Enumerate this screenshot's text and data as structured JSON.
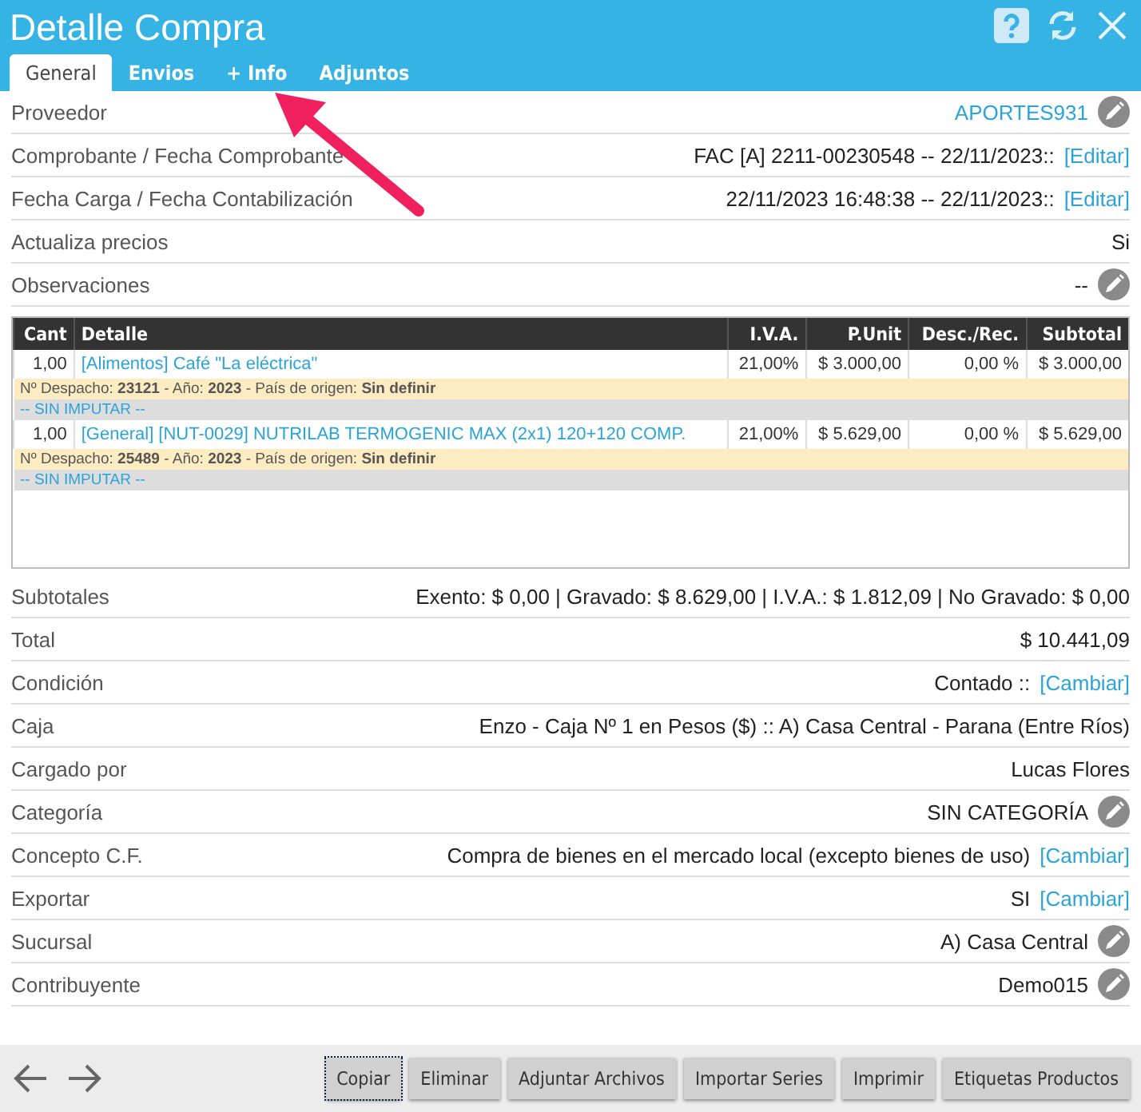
{
  "window": {
    "title": "Detalle Compra"
  },
  "tabs": [
    {
      "label": "General",
      "selected": true
    },
    {
      "label": "Envios",
      "selected": false
    },
    {
      "label": "+ Info",
      "selected": false
    },
    {
      "label": "Adjuntos",
      "selected": false
    }
  ],
  "annotation": {
    "kind": "arrow"
  },
  "header_fields": [
    {
      "label": "Proveedor",
      "value": "APORTES931",
      "kind": "link",
      "editable": true
    },
    {
      "label": "Comprobante / Fecha Comprobante",
      "value": "FAC [A] 2211-00230548 -- 22/11/2023::",
      "kind": "plain",
      "action": "[Editar]",
      "editable": false
    },
    {
      "label": "Fecha Carga / Fecha Contabilización",
      "value": "22/11/2023 16:48:38 -- 22/11/2023::",
      "kind": "plain",
      "action": "[Editar]",
      "editable": false
    },
    {
      "label": "Actualiza precios",
      "value": "Si",
      "kind": "plain",
      "editable": false
    },
    {
      "label": "Observaciones",
      "value": "--",
      "kind": "plain",
      "editable": true
    }
  ],
  "table": {
    "columns": [
      "Cant",
      "Detalle",
      "I.V.A.",
      "P.Unit",
      "Desc./Rec.",
      "Subtotal"
    ],
    "rows": [
      {
        "cells": [
          "1,00",
          "[Alimentos] Café \"La eléctrica\"",
          "21,00%",
          "$ 3.000,00",
          "0,00 %",
          "$ 3.000,00"
        ],
        "meta": "Nº Despacho: **23121** - Año: **2023** - País de origen: **Sin definir**",
        "imputation": "-- SIN IMPUTAR --"
      },
      {
        "cells": [
          "1,00",
          "[General] [NUT-0029] NUTRILAB TERMOGENIC MAX (2x1) 120+120 COMP.",
          "21,00%",
          "$ 5.629,00",
          "0,00 %",
          "$ 5.629,00"
        ],
        "meta": "Nº Despacho: **25489** - Año: **2023** - País de origen: **Sin definir**",
        "imputation": "-- SIN IMPUTAR --"
      }
    ]
  },
  "summary_fields": [
    {
      "label": "Subtotales",
      "value": "Exento: $ 0,00 | Gravado: $ 8.629,00 | I.V.A.: $ 1.812,09 | No Gravado: $ 0,00",
      "kind": "plain",
      "editable": false
    },
    {
      "label": "Total",
      "value": "$ 10.441,09",
      "kind": "plain",
      "editable": false
    },
    {
      "label": "Condición",
      "value": "Contado ::",
      "kind": "plain",
      "action": "[Cambiar]",
      "editable": false
    },
    {
      "label": "Caja",
      "value": "Enzo - Caja Nº 1 en Pesos ($) :: A) Casa Central - Parana (Entre Ríos)",
      "kind": "plain",
      "editable": false
    },
    {
      "label": "Cargado por",
      "value": "Lucas Flores",
      "kind": "plain",
      "editable": false
    },
    {
      "label": "Categoría",
      "value": "SIN CATEGORÍA",
      "kind": "plain",
      "editable": true
    },
    {
      "label": "Concepto C.F.",
      "value": "Compra de bienes en el mercado local (excepto bienes de uso)",
      "kind": "plain",
      "action": "[Cambiar]",
      "editable": false
    },
    {
      "label": "Exportar",
      "value": "SI",
      "kind": "plain",
      "action": "[Cambiar]",
      "editable": false
    },
    {
      "label": "Sucursal",
      "value": "A) Casa Central",
      "kind": "plain",
      "editable": true
    },
    {
      "label": "Contribuyente",
      "value": "Demo015",
      "kind": "plain",
      "editable": true
    }
  ],
  "footer": {
    "buttons": [
      {
        "label": "Copiar",
        "focused": true
      },
      {
        "label": "Eliminar",
        "focused": false
      },
      {
        "label": "Adjuntar Archivos",
        "focused": false
      },
      {
        "label": "Importar Series",
        "focused": false
      },
      {
        "label": "Imprimir",
        "focused": false
      },
      {
        "label": "Etiquetas Productos",
        "focused": false
      }
    ]
  }
}
